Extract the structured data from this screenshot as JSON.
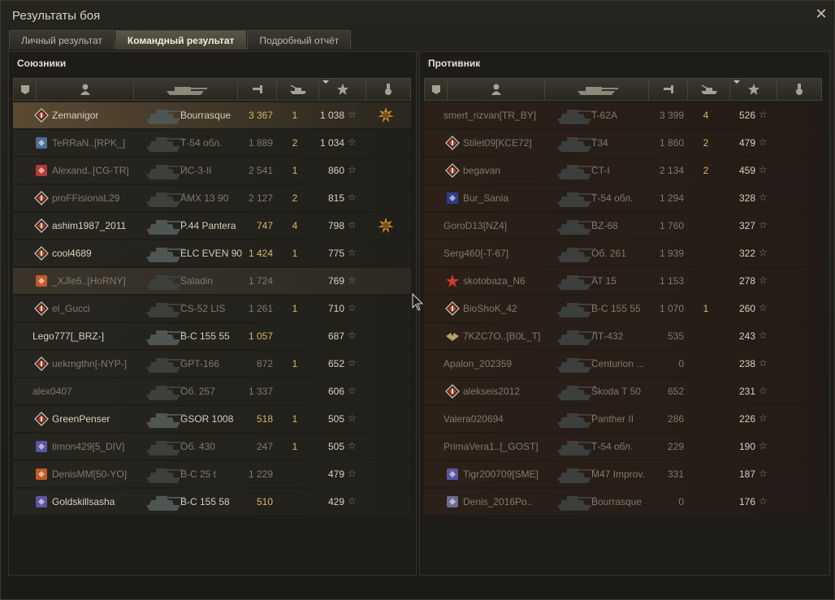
{
  "window": {
    "title": "Результаты боя"
  },
  "tabs": [
    {
      "label": "Личный результат",
      "active": false
    },
    {
      "label": "Командный результат",
      "active": true
    },
    {
      "label": "Подробный отчёт",
      "active": false
    }
  ],
  "allies": {
    "title": "Союзники",
    "rows": [
      {
        "name": "Zemanigor",
        "vehicle": "Bourrasque",
        "damage": "3 367",
        "kills": "1",
        "xp": "1 038",
        "medal": true,
        "badge": "rank",
        "style": "me",
        "dead": false
      },
      {
        "name": "TeRRaN..[RPK_]",
        "vehicle": "Т-54 обл.",
        "damage": "1 889",
        "kills": "2",
        "xp": "1 034",
        "medal": false,
        "badge": "clan",
        "style": "",
        "dead": true
      },
      {
        "name": "Alexand..[CG-TR]",
        "vehicle": "ИС-3-II",
        "damage": "2 541",
        "kills": "1",
        "xp": "860",
        "medal": false,
        "badge": "clan2",
        "style": "",
        "dead": true
      },
      {
        "name": "proFFisionaL29",
        "vehicle": "AMX 13 90",
        "damage": "2 127",
        "kills": "2",
        "xp": "815",
        "medal": false,
        "badge": "rank",
        "style": "",
        "dead": true
      },
      {
        "name": "ashim1987_2011",
        "vehicle": "P.44 Pantera",
        "damage": "747",
        "kills": "4",
        "xp": "798",
        "medal": true,
        "badge": "rank",
        "style": "",
        "dead": false
      },
      {
        "name": "cool4689",
        "vehicle": "ELC EVEN 90",
        "damage": "1 424",
        "kills": "1",
        "xp": "775",
        "medal": false,
        "badge": "rank",
        "style": "",
        "dead": false
      },
      {
        "name": "_XJle6..[HoRNY]",
        "vehicle": "Saladin",
        "damage": "1 724",
        "kills": "",
        "xp": "769",
        "medal": false,
        "badge": "clan3",
        "style": "hl",
        "dead": true
      },
      {
        "name": "el_Gucci",
        "vehicle": "CS-52 LIS",
        "damage": "1 261",
        "kills": "1",
        "xp": "710",
        "medal": false,
        "badge": "rank",
        "style": "",
        "dead": true
      },
      {
        "name": "Lego777[_BRZ-]",
        "vehicle": "B-C 155 55",
        "damage": "1 057",
        "kills": "",
        "xp": "687",
        "medal": false,
        "badge": "",
        "style": "",
        "dead": false
      },
      {
        "name": "uekmgthn[-NYP-]",
        "vehicle": "GPT-166",
        "damage": "872",
        "kills": "1",
        "xp": "652",
        "medal": false,
        "badge": "rank",
        "style": "",
        "dead": true
      },
      {
        "name": "alex0407",
        "vehicle": "Об. 257",
        "damage": "1 337",
        "kills": "",
        "xp": "606",
        "medal": false,
        "badge": "",
        "style": "",
        "dead": true
      },
      {
        "name": "GreenPenser",
        "vehicle": "GSOR 1008",
        "damage": "518",
        "kills": "1",
        "xp": "505",
        "medal": false,
        "badge": "rank",
        "style": "",
        "dead": false
      },
      {
        "name": "timon429[5_DIV]",
        "vehicle": "Об. 430",
        "damage": "247",
        "kills": "1",
        "xp": "505",
        "medal": false,
        "badge": "clan4",
        "style": "",
        "dead": true
      },
      {
        "name": "DenisMM[50-YO]",
        "vehicle": "B-C 25 t",
        "damage": "1 229",
        "kills": "",
        "xp": "479",
        "medal": false,
        "badge": "clan3",
        "style": "",
        "dead": true
      },
      {
        "name": "Goldskillsasha",
        "vehicle": "B-C 155 58",
        "damage": "510",
        "kills": "",
        "xp": "429",
        "medal": false,
        "badge": "clan4",
        "style": "",
        "dead": false
      }
    ]
  },
  "enemies": {
    "title": "Противник",
    "rows": [
      {
        "name": "smert_rizvan[TR_BY]",
        "vehicle": "T-62A",
        "damage": "3 399",
        "kills": "4",
        "xp": "526",
        "badge": "",
        "dead": true
      },
      {
        "name": "Stilet09[KCE72]",
        "vehicle": "T34",
        "damage": "1 860",
        "kills": "2",
        "xp": "479",
        "badge": "rank",
        "dead": true
      },
      {
        "name": "begavan",
        "vehicle": "CT-I",
        "damage": "2 134",
        "kills": "2",
        "xp": "459",
        "badge": "rank",
        "dead": true
      },
      {
        "name": "Bur_Sania",
        "vehicle": "Т-54 обл.",
        "damage": "1 294",
        "kills": "",
        "xp": "328",
        "badge": "clan5",
        "dead": true
      },
      {
        "name": "GoroD13[NZ4]",
        "vehicle": "BZ-68",
        "damage": "1 760",
        "kills": "",
        "xp": "327",
        "badge": "",
        "dead": true
      },
      {
        "name": "Serg460[-T-67]",
        "vehicle": "Об. 261",
        "damage": "1 939",
        "kills": "",
        "xp": "322",
        "badge": "",
        "dead": true
      },
      {
        "name": "skotobaza_N6",
        "vehicle": "AT 15",
        "damage": "1 153",
        "kills": "",
        "xp": "278",
        "badge": "star",
        "dead": true
      },
      {
        "name": "BioShoK_42",
        "vehicle": "B-C 155 55",
        "damage": "1 070",
        "kills": "1",
        "xp": "260",
        "badge": "rank",
        "dead": true
      },
      {
        "name": "7KZC7O..[B0L_T]",
        "vehicle": "ЛТ-432",
        "damage": "535",
        "kills": "",
        "xp": "243",
        "badge": "wings",
        "dead": true
      },
      {
        "name": "Apalon_202359",
        "vehicle": "Centurion ...",
        "damage": "0",
        "kills": "",
        "xp": "238",
        "badge": "",
        "dead": true
      },
      {
        "name": "alekseis2012",
        "vehicle": "Škoda T 50",
        "damage": "652",
        "kills": "",
        "xp": "231",
        "badge": "rank",
        "dead": true
      },
      {
        "name": "Valera020694",
        "vehicle": "Panther II",
        "damage": "286",
        "kills": "",
        "xp": "226",
        "badge": "",
        "dead": true
      },
      {
        "name": "PrimaVera1..[_GOST]",
        "vehicle": "Т-54 обл.",
        "damage": "229",
        "kills": "",
        "xp": "190",
        "badge": "",
        "dead": true
      },
      {
        "name": "Tigr200709[SME]",
        "vehicle": "M47 Improv.",
        "damage": "331",
        "kills": "",
        "xp": "187",
        "badge": "clan4",
        "dead": true
      },
      {
        "name": "Denis_2016Po..",
        "vehicle": "Bourrasque",
        "damage": "0",
        "kills": "",
        "xp": "176",
        "badge": "clan6",
        "dead": true
      }
    ]
  },
  "icons": {
    "close": "close-icon",
    "header": [
      "platoon-icon",
      "player-icon",
      "tank-icon",
      "damage-icon",
      "kills-icon",
      "xp-icon",
      "medal-icon"
    ],
    "star": "☆"
  },
  "colors": {
    "damage": "#d9b56b",
    "dimmed": "#7f7a6c",
    "self_row": "#5a4a33"
  }
}
